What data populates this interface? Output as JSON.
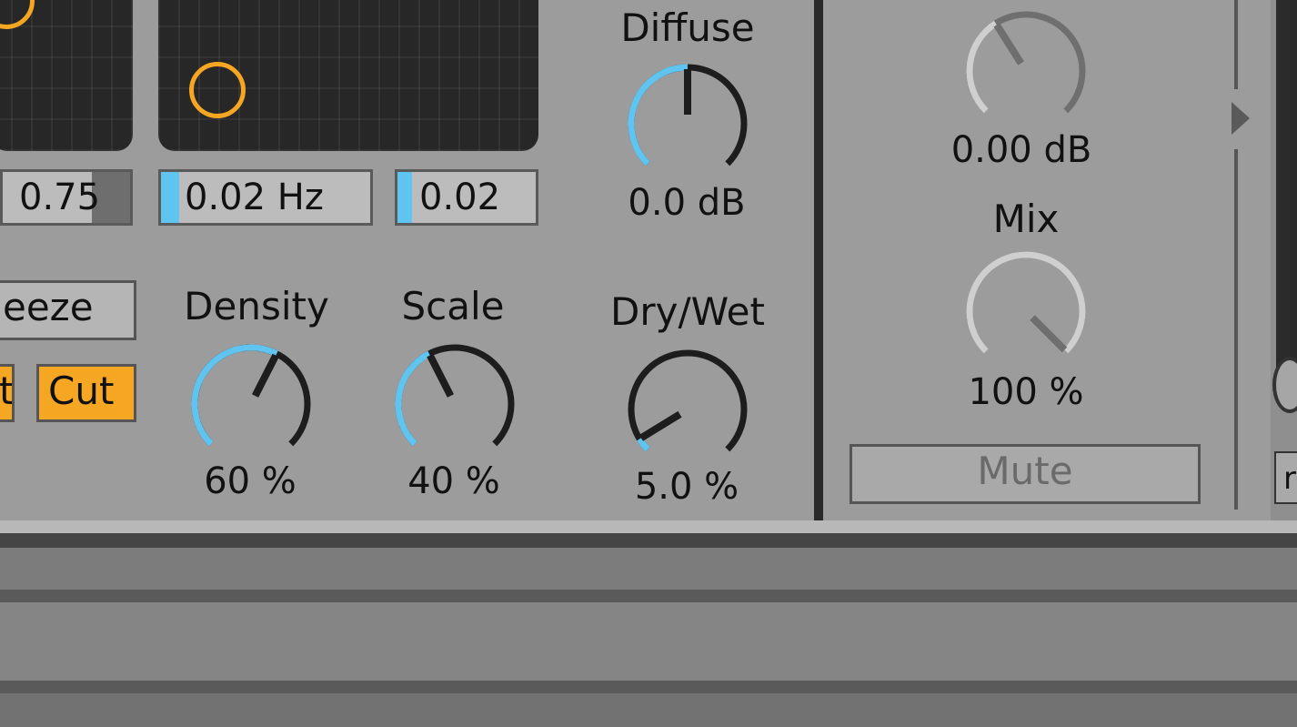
{
  "colors": {
    "accent_blue": "#5fc4f0",
    "accent_orange": "#f5a623",
    "panel": "#9c9c9c",
    "dark": "#272727"
  },
  "fields": {
    "left_value": "0.75",
    "rate_value": "0.02 Hz",
    "amount_value": "0.02"
  },
  "buttons": {
    "freeze": "eeze",
    "cut_partial": "t",
    "cut": "Cut",
    "mute": "Mute"
  },
  "knobs": {
    "diffuse": {
      "label": "Diffuse",
      "value": "0.0 dB",
      "level": 0.5
    },
    "density": {
      "label": "Density",
      "value": "60 %",
      "level": 0.6
    },
    "scale": {
      "label": "Scale",
      "value": "40 %",
      "level": 0.4
    },
    "drywet": {
      "label": "Dry/Wet",
      "value": "5.0 %",
      "level": 0.05
    },
    "output": {
      "value": "0.00 dB",
      "level": 0.38
    },
    "mix": {
      "label": "Mix",
      "value": "100 %",
      "level": 1.0
    }
  },
  "right_edge": {
    "partial_label": "r"
  },
  "icons": {
    "expand": "triangle-right-icon"
  }
}
